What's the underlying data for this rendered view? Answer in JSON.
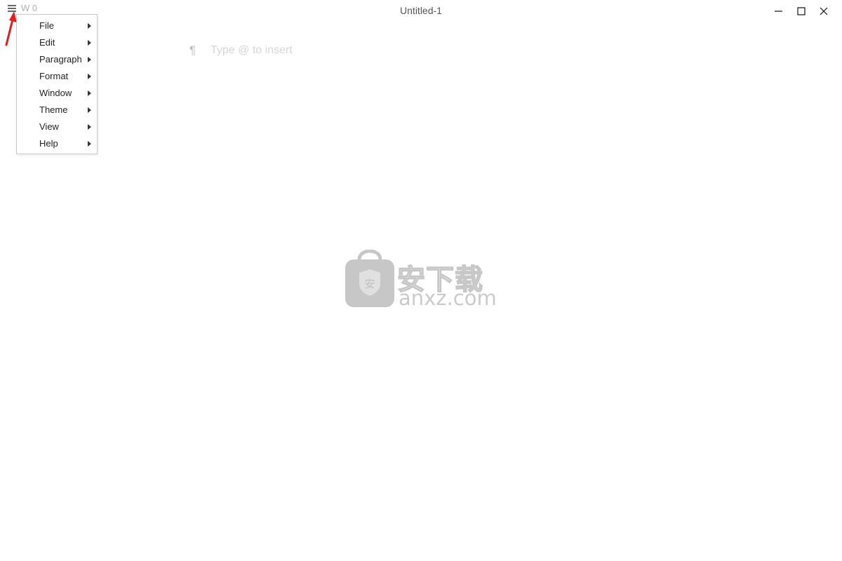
{
  "app": {
    "title": "Untitled-1",
    "word_count": "W 0"
  },
  "titlebar": {
    "menu_icon": "hamburger-icon",
    "minimize_icon": "minimize-icon",
    "maximize_icon": "maximize-icon",
    "close_icon": "close-icon"
  },
  "menu": {
    "items": [
      {
        "label": "File"
      },
      {
        "label": "Edit"
      },
      {
        "label": "Paragraph"
      },
      {
        "label": "Format"
      },
      {
        "label": "Window"
      },
      {
        "label": "Theme"
      },
      {
        "label": "View"
      },
      {
        "label": "Help"
      }
    ]
  },
  "editor": {
    "pilcrow": "¶",
    "placeholder": "Type @ to insert"
  },
  "watermark": {
    "cn": "安下载",
    "en": "anxz.com"
  },
  "colors": {
    "annotation_arrow": "#e02020",
    "menu_border": "#c8c8c8",
    "placeholder_text": "#d6d6d6"
  }
}
